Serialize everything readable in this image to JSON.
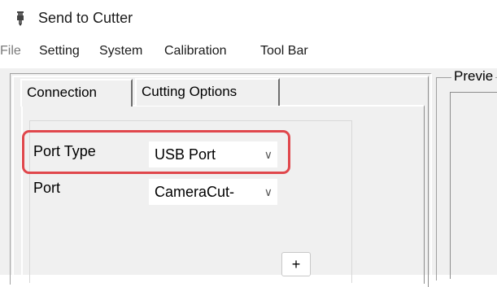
{
  "window": {
    "title": "Send to Cutter",
    "icon": "cutter-pen-icon"
  },
  "menu": {
    "items": [
      {
        "label": "File",
        "dim": true
      },
      {
        "label": "Setting",
        "dim": false
      },
      {
        "label": "System",
        "dim": false
      },
      {
        "label": "Calibration",
        "dim": false
      },
      {
        "label": "Tool Bar",
        "dim": false
      }
    ]
  },
  "tabs": [
    {
      "label": "Connection",
      "selected": true
    },
    {
      "label": "Cutting Options",
      "selected": false
    }
  ],
  "connection": {
    "port_type_label": "Port Type",
    "port_type_value": "USB Port",
    "port_label": "Port",
    "port_value": "CameraCut-",
    "add_button": "+"
  },
  "preview": {
    "label": "Previe"
  },
  "colors": {
    "highlight": "#e0474c",
    "window_bg": "#f0f0f0"
  }
}
